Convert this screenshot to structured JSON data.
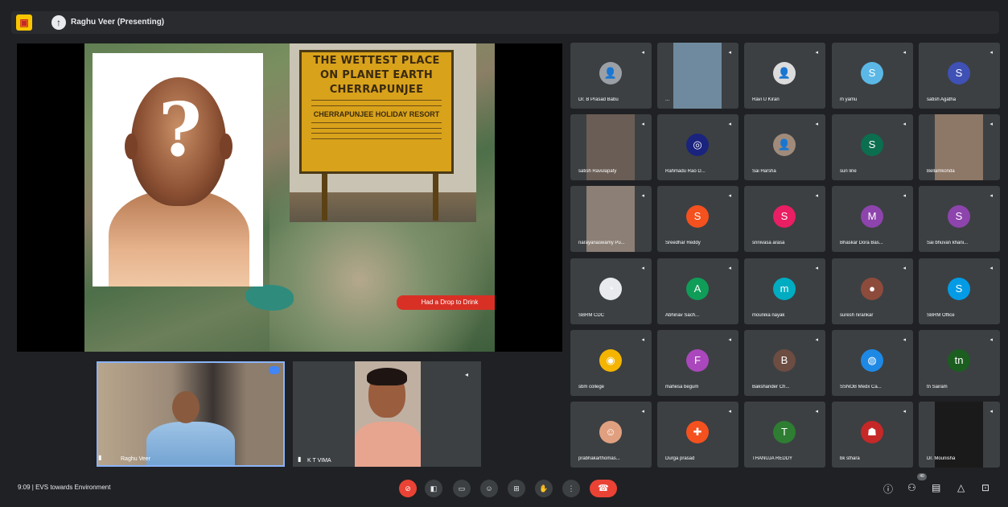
{
  "topbar": {
    "presenter_label": "Raghu Veer (Presenting)",
    "app_logo": "meet-logo"
  },
  "slide": {
    "sign_line1": "THE WETTEST PLACE",
    "sign_line2": "ON PLANET EARTH",
    "sign_line3": "CHERRAPUNJEE",
    "sign_sub": "CHERRAPUNJEE HOLIDAY RESORT",
    "cta_label": "Had a Drop to Drink"
  },
  "self_tile": {
    "name": "Raghu Veer"
  },
  "guest_tile": {
    "name": "K T VIMA"
  },
  "participants": [
    {
      "name": "Dr. B Prasad Babu",
      "type": "photo",
      "bg": "#9aa0a6",
      "initial": "👤"
    },
    {
      "name": "...",
      "type": "video",
      "bg": "#6f8a9e",
      "initial": ""
    },
    {
      "name": "Ravi U Kiran",
      "type": "photo",
      "bg": "#dcdcdc",
      "initial": "👤"
    },
    {
      "name": "m yamu",
      "type": "letter",
      "bg": "#5bb8e6",
      "initial": "S"
    },
    {
      "name": "satish Agatha",
      "type": "letter",
      "bg": "#3f51b5",
      "initial": "S"
    },
    {
      "name": "satish Ravulapaty",
      "type": "video",
      "bg": "#6a5d55",
      "initial": ""
    },
    {
      "name": "Rahmadu Rao D...",
      "type": "photo",
      "bg": "#1a237e",
      "initial": "◎"
    },
    {
      "name": "Sai Harsha",
      "type": "photo",
      "bg": "#a08b7a",
      "initial": "👤"
    },
    {
      "name": "sun line",
      "type": "letter",
      "bg": "#0b6e4f",
      "initial": "S"
    },
    {
      "name": "Bellamkonda",
      "type": "video",
      "bg": "#8d7766",
      "initial": ""
    },
    {
      "name": "narayanaswamy Pu...",
      "type": "video",
      "bg": "#8c7f76",
      "initial": ""
    },
    {
      "name": "Sreedhar Reddy",
      "type": "letter",
      "bg": "#f4511e",
      "initial": "S"
    },
    {
      "name": "srinivasa arasa",
      "type": "letter",
      "bg": "#e91e63",
      "initial": "S"
    },
    {
      "name": "Bhaskar Dora Bas...",
      "type": "letter",
      "bg": "#8e44ad",
      "initial": "M"
    },
    {
      "name": "Sai bhuvan khani...",
      "type": "letter",
      "bg": "#8e44ad",
      "initial": "S"
    },
    {
      "name": "SBRM CDC",
      "type": "photo",
      "bg": "#e8eaed",
      "initial": "◔"
    },
    {
      "name": "Abhinav Sach...",
      "type": "letter",
      "bg": "#0f9d58",
      "initial": "A"
    },
    {
      "name": "mounika nayak",
      "type": "letter",
      "bg": "#00acc1",
      "initial": "m"
    },
    {
      "name": "suresh nirankar",
      "type": "photo",
      "bg": "#8d4b3c",
      "initial": "●"
    },
    {
      "name": "SBRM Office",
      "type": "letter",
      "bg": "#039be5",
      "initial": "S"
    },
    {
      "name": "sbm college",
      "type": "photo",
      "bg": "#f4b400",
      "initial": "◉"
    },
    {
      "name": "mahesa begum",
      "type": "letter",
      "bg": "#ab47bc",
      "initial": "F"
    },
    {
      "name": "Bakshander Ch...",
      "type": "letter",
      "bg": "#6d4c41",
      "initial": "B"
    },
    {
      "name": "SSNOB Medx Ca...",
      "type": "photo",
      "bg": "#1e88e5",
      "initial": "◍"
    },
    {
      "name": "tn Sairam",
      "type": "letter",
      "bg": "#1b5e20",
      "initial": "tn"
    },
    {
      "name": "prabhakarthomas...",
      "type": "photo",
      "bg": "#e0a080",
      "initial": "☺"
    },
    {
      "name": "Durga prasad",
      "type": "photo",
      "bg": "#f4511e",
      "initial": "✚"
    },
    {
      "name": "THANUJA REDDY",
      "type": "letter",
      "bg": "#2e7d32",
      "initial": "T"
    },
    {
      "name": "bk sthara",
      "type": "photo",
      "bg": "#c62828",
      "initial": "☗"
    },
    {
      "name": "Dr. Mounisha",
      "type": "video",
      "bg": "#1a1a1a",
      "initial": ""
    }
  ],
  "bottombar": {
    "meeting_info": "9:09 | EVS towards Environment",
    "participant_count": "40"
  }
}
